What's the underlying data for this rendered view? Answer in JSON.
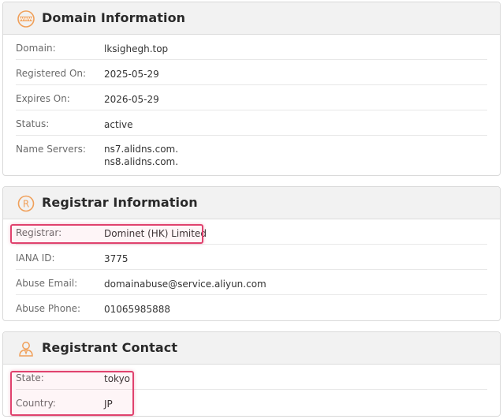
{
  "domain_info": {
    "title": "Domain Information",
    "icon": "www-icon",
    "rows": [
      {
        "label": "Domain:",
        "value": "lksighegh.top"
      },
      {
        "label": "Registered On:",
        "value": "2025-05-29"
      },
      {
        "label": "Expires On:",
        "value": "2026-05-29"
      },
      {
        "label": "Status:",
        "value": "active"
      },
      {
        "label": "Name Servers:",
        "values": [
          "ns7.alidns.com.",
          "ns8.alidns.com."
        ]
      }
    ]
  },
  "registrar_info": {
    "title": "Registrar Information",
    "icon": "registered-icon",
    "rows": [
      {
        "label": "Registrar:",
        "value": "Dominet (HK) Limited"
      },
      {
        "label": "IANA ID:",
        "value": "3775"
      },
      {
        "label": "Abuse Email:",
        "value": "domainabuse@service.aliyun.com"
      },
      {
        "label": "Abuse Phone:",
        "value": "01065985888"
      }
    ]
  },
  "registrant_contact": {
    "title": "Registrant Contact",
    "icon": "person-icon",
    "rows": [
      {
        "label": "State:",
        "value": "tokyo"
      },
      {
        "label": "Country:",
        "value": "JP"
      }
    ]
  },
  "colors": {
    "accent_icon": "#f0a05a",
    "highlight_border": "#e0426e"
  }
}
